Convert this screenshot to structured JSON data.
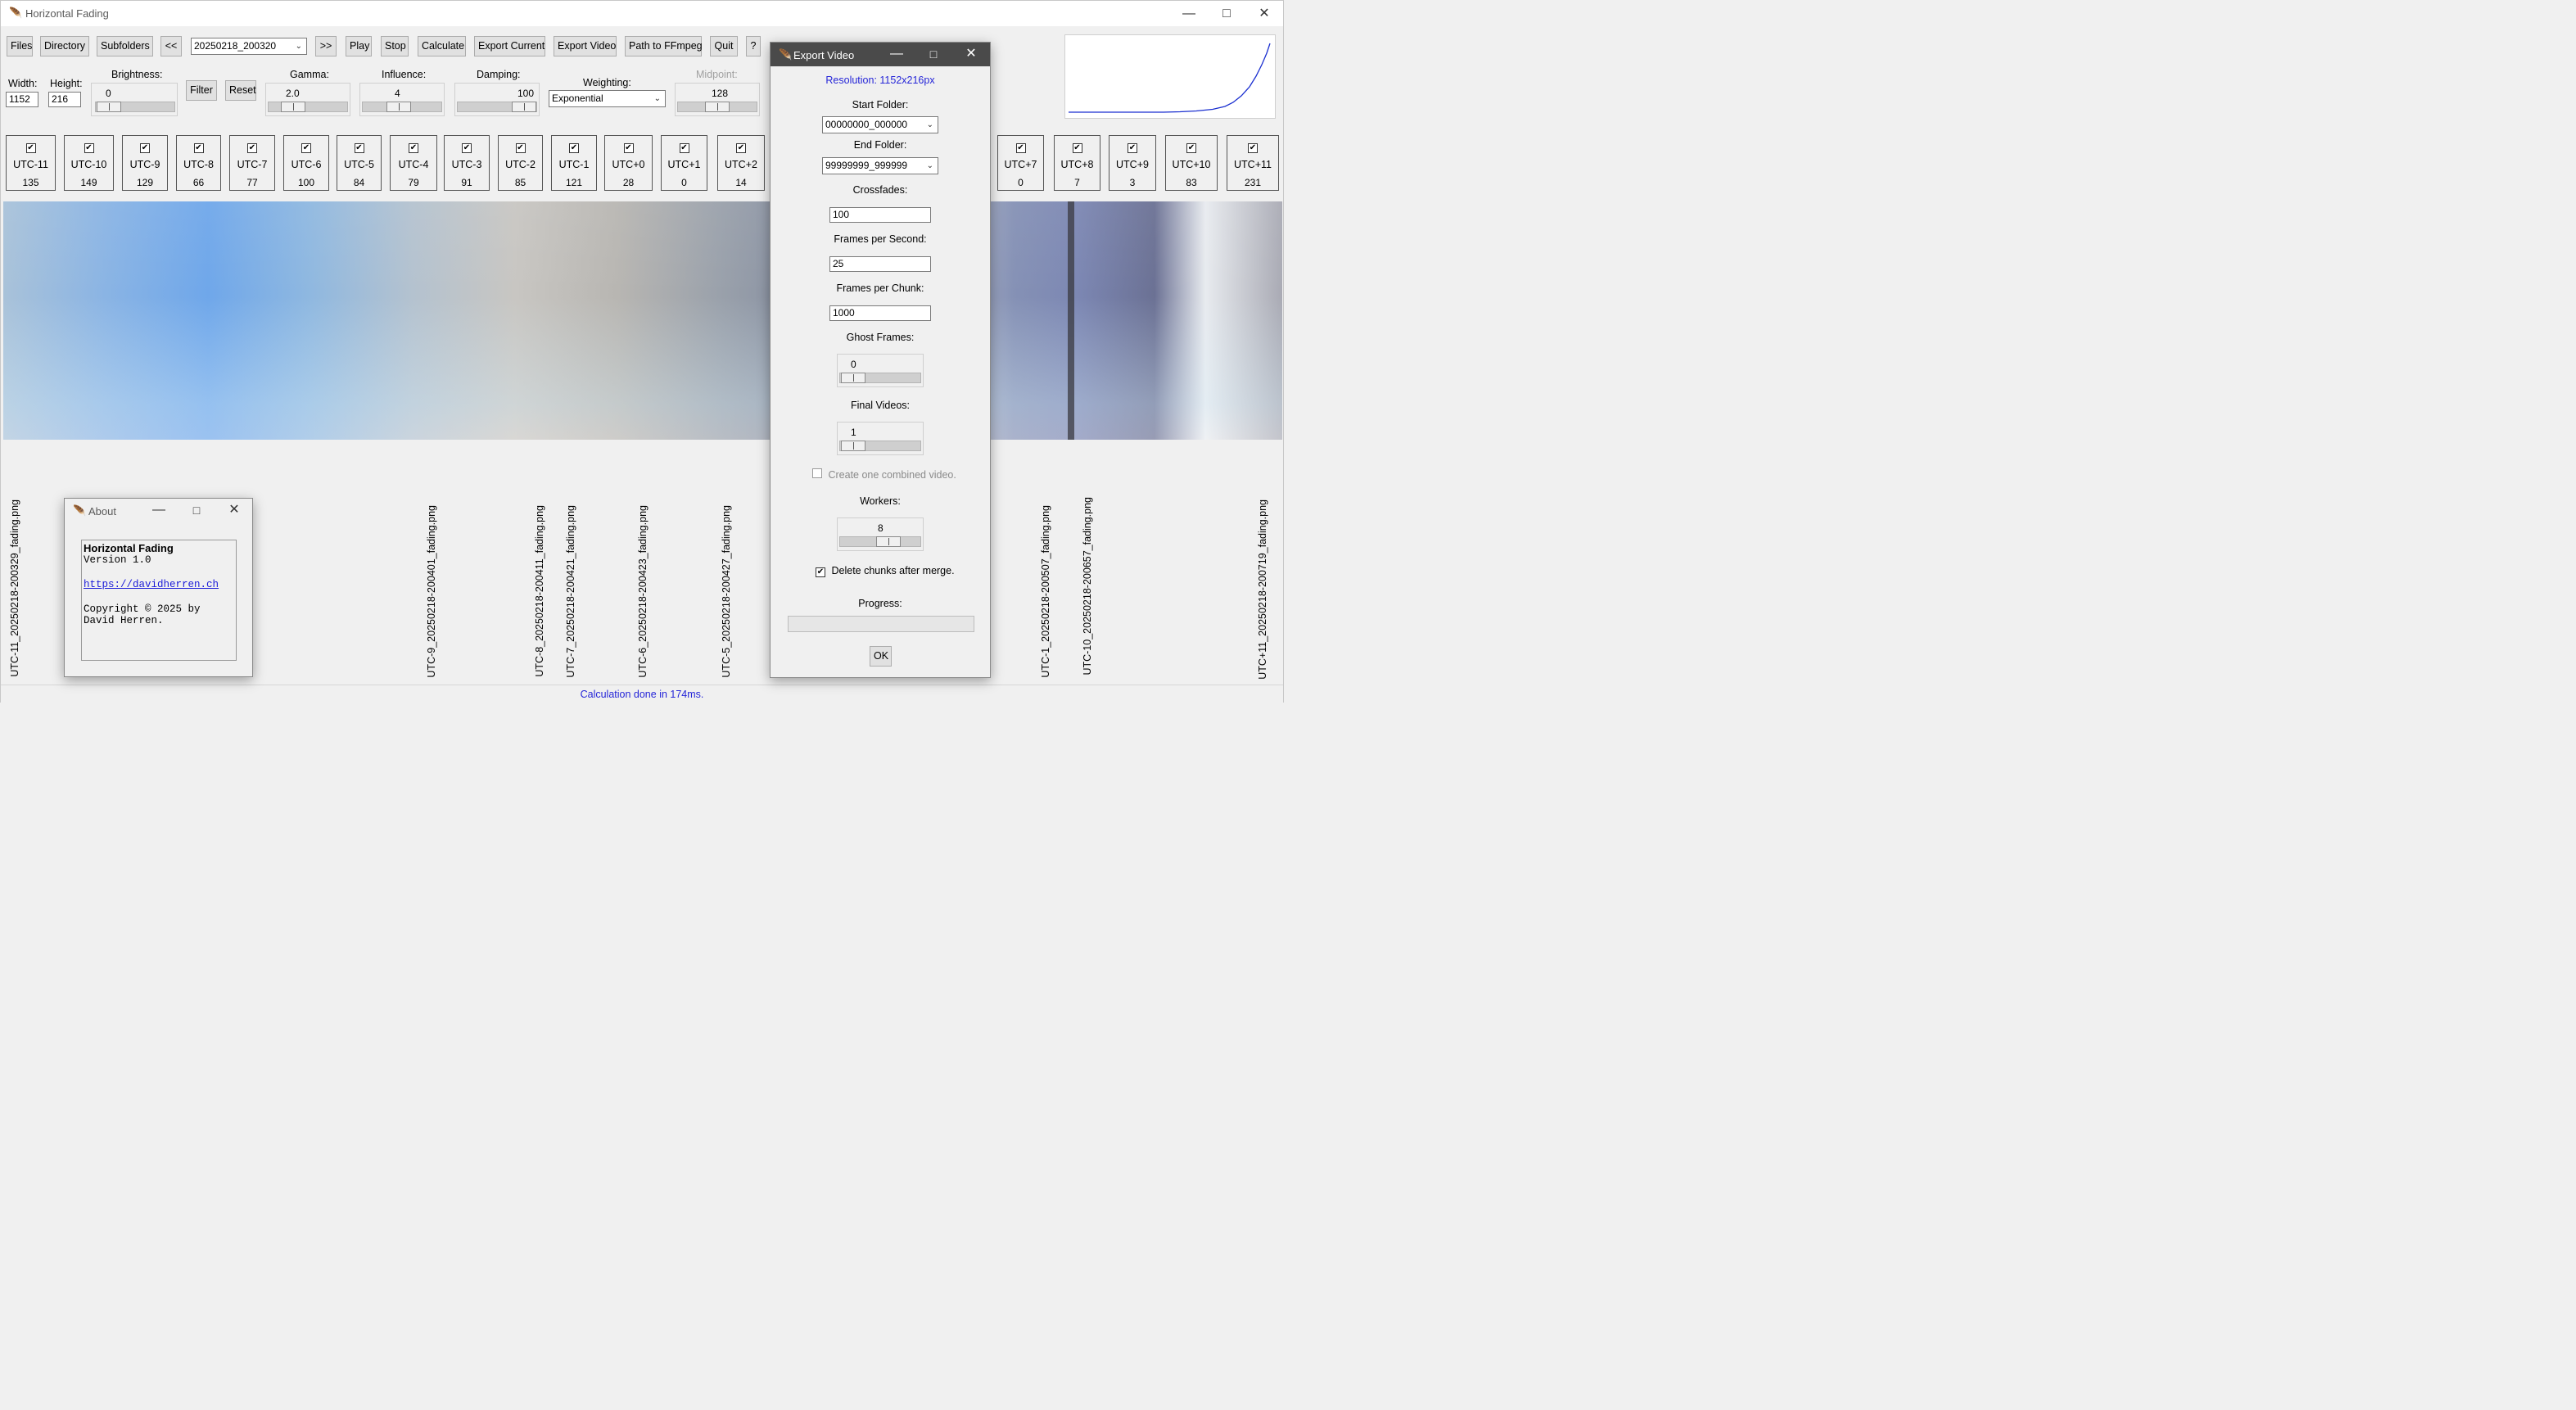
{
  "window": {
    "title": "Horizontal Fading"
  },
  "toolbar": {
    "files": "Files",
    "directory": "Directory",
    "subfolders": "Subfolders",
    "prev": "<<",
    "folder_selected": "20250218_200320",
    "next": ">>",
    "play": "Play",
    "stop": "Stop",
    "calculate": "Calculate",
    "export_current": "Export Current",
    "export_video": "Export Video",
    "path_ffmpeg": "Path to FFmpeg",
    "quit": "Quit",
    "help": "?"
  },
  "controls": {
    "width_label": "Width:",
    "width_value": "1152",
    "height_label": "Height:",
    "height_value": "216",
    "brightness_label": "Brightness:",
    "brightness_value": "0",
    "filter": "Filter",
    "reset": "Reset",
    "gamma_label": "Gamma:",
    "gamma_value": "2.0",
    "influence_label": "Influence:",
    "influence_value": "4",
    "damping_label": "Damping:",
    "damping_value": "100",
    "weighting_label": "Weighting:",
    "weighting_value": "Exponential",
    "midpoint_label": "Midpoint:",
    "midpoint_value": "128"
  },
  "timezones": [
    {
      "label": "UTC-11",
      "value": "135"
    },
    {
      "label": "UTC-10",
      "value": "149"
    },
    {
      "label": "UTC-9",
      "value": "129"
    },
    {
      "label": "UTC-8",
      "value": "66"
    },
    {
      "label": "UTC-7",
      "value": "77"
    },
    {
      "label": "UTC-6",
      "value": "100"
    },
    {
      "label": "UTC-5",
      "value": "84"
    },
    {
      "label": "UTC-4",
      "value": "79"
    },
    {
      "label": "UTC-3",
      "value": "91"
    },
    {
      "label": "UTC-2",
      "value": "85"
    },
    {
      "label": "UTC-1",
      "value": "121"
    },
    {
      "label": "UTC+0",
      "value": "28"
    },
    {
      "label": "UTC+1",
      "value": "0"
    },
    {
      "label": "UTC+2",
      "value": "14"
    },
    {
      "label": "UTC+7",
      "value": "0"
    },
    {
      "label": "UTC+8",
      "value": "7"
    },
    {
      "label": "UTC+9",
      "value": "3"
    },
    {
      "label": "UTC+10",
      "value": "83"
    },
    {
      "label": "UTC+11",
      "value": "231"
    }
  ],
  "filenames": [
    "UTC-11_20250218-200329_fading.png",
    "UTC-9_20250218-200401_fading.png",
    "UTC-8_20250218-200411_fading.png",
    "UTC-7_20250218-200421_fading.png",
    "UTC-6_20250218-200423_fading.png",
    "UTC-5_20250218-200427_fading.png",
    "UTC-1_20250218-200507_fading.png",
    "UTC-10_20250218-200657_fading.png",
    "UTC+11_20250218-200719_fading.png"
  ],
  "status": "Calculation done in 174ms.",
  "about": {
    "title": "About",
    "app_name": "Horizontal Fading",
    "version": "Version 1.0",
    "url": "https://davidherren.ch",
    "copyright_1": "Copyright © 2025 by",
    "copyright_2": "David Herren."
  },
  "export_dialog": {
    "title": "Export Video",
    "resolution": "Resolution: 1152x216px",
    "start_folder_label": "Start Folder:",
    "start_folder_value": "00000000_000000",
    "end_folder_label": "End Folder:",
    "end_folder_value": "99999999_999999",
    "crossfades_label": "Crossfades:",
    "crossfades_value": "100",
    "fps_label": "Frames per Second:",
    "fps_value": "25",
    "fpc_label": "Frames per Chunk:",
    "fpc_value": "1000",
    "ghost_label": "Ghost Frames:",
    "ghost_value": "0",
    "final_label": "Final Videos:",
    "final_value": "1",
    "combined_label": "Create one combined video.",
    "workers_label": "Workers:",
    "workers_value": "8",
    "delete_label": "Delete chunks after merge.",
    "progress_label": "Progress:",
    "progress_fraction": 0,
    "ok": "OK"
  },
  "colors": {
    "status_text": "#2525d8",
    "resolution_text": "#2525d8",
    "curve": "#1a2fd0",
    "link": "#1a1ad8"
  },
  "icons": {
    "app": "feather-icon",
    "minimize": "minimize-icon",
    "maximize": "maximize-icon",
    "close": "close-icon"
  }
}
